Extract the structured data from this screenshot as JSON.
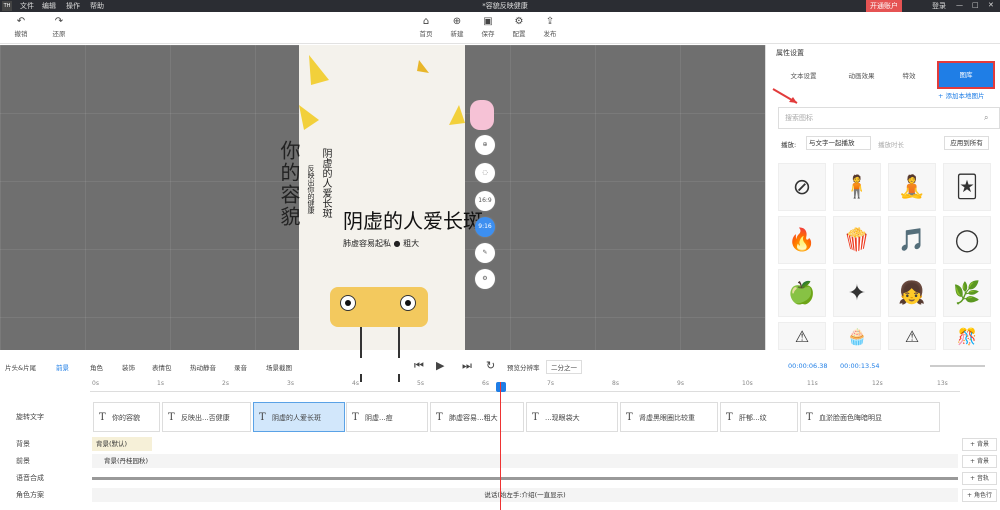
{
  "menubar": {
    "logo": "TH",
    "items": [
      "文件",
      "编辑",
      "操作",
      "帮助"
    ],
    "title": "*容貌反映健康",
    "vip": "开通账户",
    "login": "登录",
    "win_min": "—",
    "win_max": "□",
    "win_close": "✕"
  },
  "toolbar": {
    "undo": "撤销",
    "redo": "还原",
    "home": "首页",
    "new": "新建",
    "save": "保存",
    "config": "配置",
    "publish": "发布"
  },
  "poster": {
    "big_title": "你的容貌",
    "line1": "反映出你的健康",
    "line2": "阴虚的人爱长斑",
    "headline": "阴虚的人爱长斑",
    "subtitle": "肺虚容易起私 ● 粗大"
  },
  "canvas_tools": [
    "⊕",
    "◌",
    "16:9",
    "9:16",
    "✎",
    "⚙"
  ],
  "right_panel": {
    "header": "属性设置",
    "tabs": [
      "文本设置",
      "动画效果",
      "特效",
      "图库"
    ],
    "active_tab": "图库",
    "add_local": "+ 添加本地图片",
    "search_placeholder": "搜索图标",
    "play_label": "播放:",
    "play_mode": "与文字一起播放",
    "play_mode2": "播放时长",
    "apply_all": "应用到所有",
    "stickers": [
      "⊘",
      "🧍",
      "🧘",
      "🃏",
      "🔥",
      "🍿",
      "🎵",
      "◯",
      "🍏",
      "✦",
      "👧",
      "🌿",
      "⚠",
      "🧁",
      "⚠",
      "🎊"
    ]
  },
  "timeline": {
    "tools": [
      "片头&片尾",
      "前景",
      "角色",
      "装饰",
      "表情包",
      "热动静音",
      "录音",
      "场景截图"
    ],
    "preview_label": "预览分辨率",
    "resolution": "二分之一",
    "time_current": "00:00:06.38",
    "time_total": "00:00:13.54",
    "ruler": [
      "0s",
      "1s",
      "2s",
      "3s",
      "4s",
      "5s",
      "6s",
      "7s",
      "8s",
      "9s",
      "10s",
      "11s",
      "12s",
      "13s"
    ],
    "tracks": {
      "subtitle": "旋转文字",
      "bg": "背景",
      "fg": "前景",
      "voice": "语音合成",
      "role": "角色方案"
    },
    "clips": [
      "你的容貌",
      "反映出...否健康",
      "阴虚的人爱长斑",
      "阴虚...痘",
      "肺虚容易...粗大",
      "...现眼袋大",
      "肾虚黑眼圈比较重",
      "肝郁...纹",
      "血淤脸面色晦暗明显"
    ],
    "bg_clip": "背景(默认)",
    "fg_clip": "背景(丹桂园秋)",
    "voice_clip": "说话(始左手:介绍(一直显示)",
    "add_bg": "+ 背景",
    "add_fg": "+ 背景",
    "add_audio": "+ 音轨",
    "add_role": "+ 角色行"
  },
  "colors": {
    "accent": "#1f7ee6",
    "highlight": "#e23b3b",
    "monster": "#f3c95e"
  }
}
